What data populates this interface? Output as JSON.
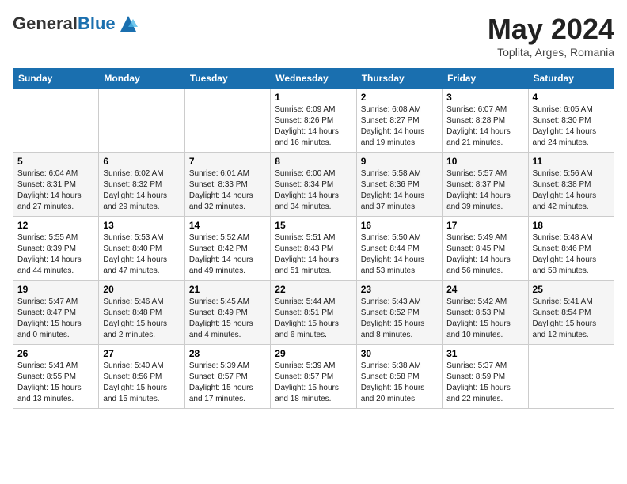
{
  "header": {
    "logo_general": "General",
    "logo_blue": "Blue",
    "month_title": "May 2024",
    "location": "Toplita, Arges, Romania"
  },
  "days_of_week": [
    "Sunday",
    "Monday",
    "Tuesday",
    "Wednesday",
    "Thursday",
    "Friday",
    "Saturday"
  ],
  "weeks": [
    [
      {
        "day": "",
        "content": ""
      },
      {
        "day": "",
        "content": ""
      },
      {
        "day": "",
        "content": ""
      },
      {
        "day": "1",
        "content": "Sunrise: 6:09 AM\nSunset: 8:26 PM\nDaylight: 14 hours and 16 minutes."
      },
      {
        "day": "2",
        "content": "Sunrise: 6:08 AM\nSunset: 8:27 PM\nDaylight: 14 hours and 19 minutes."
      },
      {
        "day": "3",
        "content": "Sunrise: 6:07 AM\nSunset: 8:28 PM\nDaylight: 14 hours and 21 minutes."
      },
      {
        "day": "4",
        "content": "Sunrise: 6:05 AM\nSunset: 8:30 PM\nDaylight: 14 hours and 24 minutes."
      }
    ],
    [
      {
        "day": "5",
        "content": "Sunrise: 6:04 AM\nSunset: 8:31 PM\nDaylight: 14 hours and 27 minutes."
      },
      {
        "day": "6",
        "content": "Sunrise: 6:02 AM\nSunset: 8:32 PM\nDaylight: 14 hours and 29 minutes."
      },
      {
        "day": "7",
        "content": "Sunrise: 6:01 AM\nSunset: 8:33 PM\nDaylight: 14 hours and 32 minutes."
      },
      {
        "day": "8",
        "content": "Sunrise: 6:00 AM\nSunset: 8:34 PM\nDaylight: 14 hours and 34 minutes."
      },
      {
        "day": "9",
        "content": "Sunrise: 5:58 AM\nSunset: 8:36 PM\nDaylight: 14 hours and 37 minutes."
      },
      {
        "day": "10",
        "content": "Sunrise: 5:57 AM\nSunset: 8:37 PM\nDaylight: 14 hours and 39 minutes."
      },
      {
        "day": "11",
        "content": "Sunrise: 5:56 AM\nSunset: 8:38 PM\nDaylight: 14 hours and 42 minutes."
      }
    ],
    [
      {
        "day": "12",
        "content": "Sunrise: 5:55 AM\nSunset: 8:39 PM\nDaylight: 14 hours and 44 minutes."
      },
      {
        "day": "13",
        "content": "Sunrise: 5:53 AM\nSunset: 8:40 PM\nDaylight: 14 hours and 47 minutes."
      },
      {
        "day": "14",
        "content": "Sunrise: 5:52 AM\nSunset: 8:42 PM\nDaylight: 14 hours and 49 minutes."
      },
      {
        "day": "15",
        "content": "Sunrise: 5:51 AM\nSunset: 8:43 PM\nDaylight: 14 hours and 51 minutes."
      },
      {
        "day": "16",
        "content": "Sunrise: 5:50 AM\nSunset: 8:44 PM\nDaylight: 14 hours and 53 minutes."
      },
      {
        "day": "17",
        "content": "Sunrise: 5:49 AM\nSunset: 8:45 PM\nDaylight: 14 hours and 56 minutes."
      },
      {
        "day": "18",
        "content": "Sunrise: 5:48 AM\nSunset: 8:46 PM\nDaylight: 14 hours and 58 minutes."
      }
    ],
    [
      {
        "day": "19",
        "content": "Sunrise: 5:47 AM\nSunset: 8:47 PM\nDaylight: 15 hours and 0 minutes."
      },
      {
        "day": "20",
        "content": "Sunrise: 5:46 AM\nSunset: 8:48 PM\nDaylight: 15 hours and 2 minutes."
      },
      {
        "day": "21",
        "content": "Sunrise: 5:45 AM\nSunset: 8:49 PM\nDaylight: 15 hours and 4 minutes."
      },
      {
        "day": "22",
        "content": "Sunrise: 5:44 AM\nSunset: 8:51 PM\nDaylight: 15 hours and 6 minutes."
      },
      {
        "day": "23",
        "content": "Sunrise: 5:43 AM\nSunset: 8:52 PM\nDaylight: 15 hours and 8 minutes."
      },
      {
        "day": "24",
        "content": "Sunrise: 5:42 AM\nSunset: 8:53 PM\nDaylight: 15 hours and 10 minutes."
      },
      {
        "day": "25",
        "content": "Sunrise: 5:41 AM\nSunset: 8:54 PM\nDaylight: 15 hours and 12 minutes."
      }
    ],
    [
      {
        "day": "26",
        "content": "Sunrise: 5:41 AM\nSunset: 8:55 PM\nDaylight: 15 hours and 13 minutes."
      },
      {
        "day": "27",
        "content": "Sunrise: 5:40 AM\nSunset: 8:56 PM\nDaylight: 15 hours and 15 minutes."
      },
      {
        "day": "28",
        "content": "Sunrise: 5:39 AM\nSunset: 8:57 PM\nDaylight: 15 hours and 17 minutes."
      },
      {
        "day": "29",
        "content": "Sunrise: 5:39 AM\nSunset: 8:57 PM\nDaylight: 15 hours and 18 minutes."
      },
      {
        "day": "30",
        "content": "Sunrise: 5:38 AM\nSunset: 8:58 PM\nDaylight: 15 hours and 20 minutes."
      },
      {
        "day": "31",
        "content": "Sunrise: 5:37 AM\nSunset: 8:59 PM\nDaylight: 15 hours and 22 minutes."
      },
      {
        "day": "",
        "content": ""
      }
    ]
  ]
}
